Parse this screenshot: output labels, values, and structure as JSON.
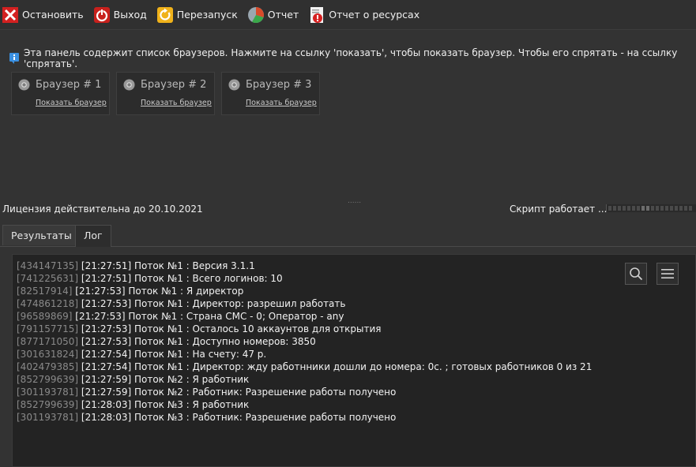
{
  "toolbar": {
    "stop": {
      "label": "Остановить",
      "icon": "stop-x-icon"
    },
    "exit": {
      "label": "Выход",
      "icon": "power-icon"
    },
    "restart": {
      "label": "Перезапуск",
      "icon": "restart-icon"
    },
    "report": {
      "label": "Отчет",
      "icon": "pie-chart-icon"
    },
    "resources_report": {
      "label": "Отчет о ресурсах",
      "icon": "alert-document-icon"
    }
  },
  "browsers_panel": {
    "info": "Эта панель содержит список браузеров. Нажмите на ссылку 'показать', чтобы показать браузер. Чтобы его спрятать - на ссылку 'спрятать'.",
    "browsers": [
      {
        "title": "Браузер # 1",
        "link": "Показать браузер"
      },
      {
        "title": "Браузер # 2",
        "link": "Показать браузер"
      },
      {
        "title": "Браузер # 3",
        "link": "Показать браузер"
      }
    ]
  },
  "splitter": {
    "grip": "......"
  },
  "status": {
    "license": "Лицензия действительна до 20.10.2021",
    "script": "Скрипт работает ..."
  },
  "tabs": [
    {
      "label": "Результаты",
      "active": false
    },
    {
      "label": "Лог",
      "active": true
    }
  ],
  "log": {
    "search_icon": "search-icon",
    "menu_icon": "hamburger-menu-icon",
    "lines": [
      {
        "id": "[434147135]",
        "text": " [21:27:51] Поток №1 : Версия 3.1.1"
      },
      {
        "id": "[741225631]",
        "text": " [21:27:51] Поток №1 : Всего логинов: 10"
      },
      {
        "id": "[82517914]",
        "text": " [21:27:53] Поток №1 : Я директор"
      },
      {
        "id": "[474861218]",
        "text": " [21:27:53] Поток №1 : Директор: разрешил работать"
      },
      {
        "id": "[96589869]",
        "text": " [21:27:53] Поток №1 : Страна СМС - 0; Оператор - any"
      },
      {
        "id": "[791157715]",
        "text": " [21:27:53] Поток №1 : Осталось 10 аккаунтов для открытия"
      },
      {
        "id": "[877171050]",
        "text": " [21:27:53] Поток №1 : Доступно номеров: 3850"
      },
      {
        "id": "[301631824]",
        "text": " [21:27:54] Поток №1 : На счету: 47 р."
      },
      {
        "id": "[402479385]",
        "text": " [21:27:54] Поток №1 : Директор: жду работнники дошли до номера: 0с. ; готовых работников 0 из 21"
      },
      {
        "id": "[852799639]",
        "text": " [21:27:59] Поток №2 : Я работник"
      },
      {
        "id": "[301193781]",
        "text": " [21:27:59] Поток №2 : Работник: Разрешение работы получено"
      },
      {
        "id": "[852799639]",
        "text": " [21:28:03] Поток №3 : Я работник"
      },
      {
        "id": "[301193781]",
        "text": " [21:28:03] Поток №3 : Работник: Разрешение работы получено"
      }
    ]
  }
}
